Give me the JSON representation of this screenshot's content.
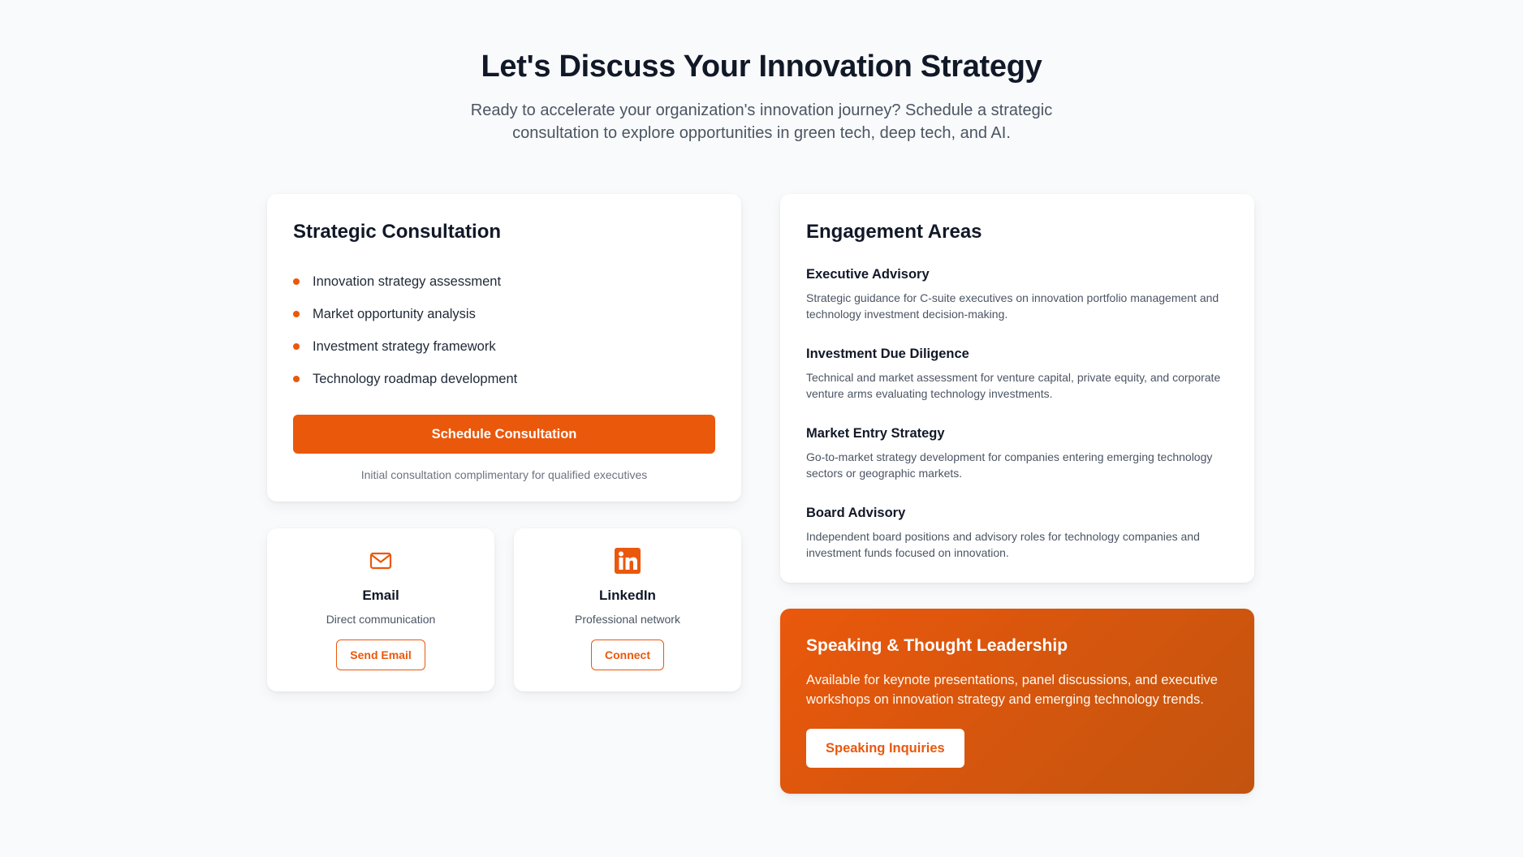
{
  "hero": {
    "title": "Let's Discuss Your Innovation Strategy",
    "subtitle": "Ready to accelerate your organization's innovation journey? Schedule a strategic consultation to explore opportunities in green tech, deep tech, and AI."
  },
  "consultation": {
    "title": "Strategic Consultation",
    "items": [
      "Innovation strategy assessment",
      "Market opportunity analysis",
      "Investment strategy framework",
      "Technology roadmap development"
    ],
    "button_label": "Schedule Consultation",
    "note": "Initial consultation complimentary for qualified executives"
  },
  "contacts": {
    "email": {
      "icon": "mail-icon",
      "title": "Email",
      "subtitle": "Direct communication",
      "button_label": "Send Email"
    },
    "linkedin": {
      "icon": "linkedin-icon",
      "title": "LinkedIn",
      "subtitle": "Professional network",
      "button_label": "Connect"
    }
  },
  "engagement": {
    "title": "Engagement Areas",
    "areas": [
      {
        "title": "Executive Advisory",
        "description": "Strategic guidance for C-suite executives on innovation portfolio management and technology investment decision-making."
      },
      {
        "title": "Investment Due Diligence",
        "description": "Technical and market assessment for venture capital, private equity, and corporate venture arms evaluating technology investments."
      },
      {
        "title": "Market Entry Strategy",
        "description": "Go-to-market strategy development for companies entering emerging technology sectors or geographic markets."
      },
      {
        "title": "Board Advisory",
        "description": "Independent board positions and advisory roles for technology companies and investment funds focused on innovation."
      }
    ]
  },
  "speaking": {
    "title": "Speaking & Thought Leadership",
    "description": "Available for keynote presentations, panel discussions, and executive workshops on innovation strategy and emerging technology trends.",
    "button_label": "Speaking Inquiries"
  },
  "colors": {
    "accent": "#ea580c",
    "background": "#f9fafb",
    "heading": "#111827",
    "body_text": "#4b5563"
  }
}
